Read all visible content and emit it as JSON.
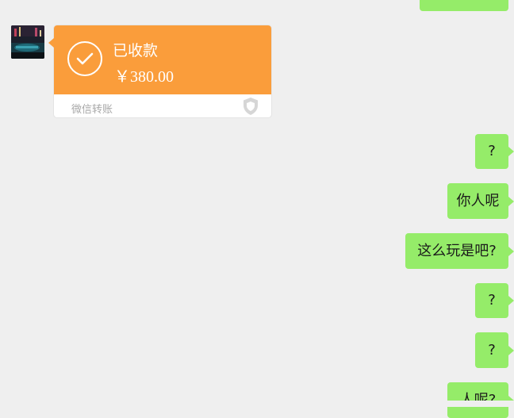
{
  "chat": {
    "transfer": {
      "status": "已收款",
      "amount": "￥380.00",
      "label": "微信转账",
      "accent_color": "#fa9d3b"
    },
    "messages": [
      {
        "text": "?"
      },
      {
        "text": "你人呢"
      },
      {
        "text": "这么玩是吧?"
      },
      {
        "text": "?"
      },
      {
        "text": "?"
      },
      {
        "text": "人呢?"
      }
    ],
    "bubble_color": "#95ec69"
  },
  "icons": {
    "check": "check-circle-icon",
    "shield": "shield-icon",
    "avatar": "contact-avatar"
  }
}
